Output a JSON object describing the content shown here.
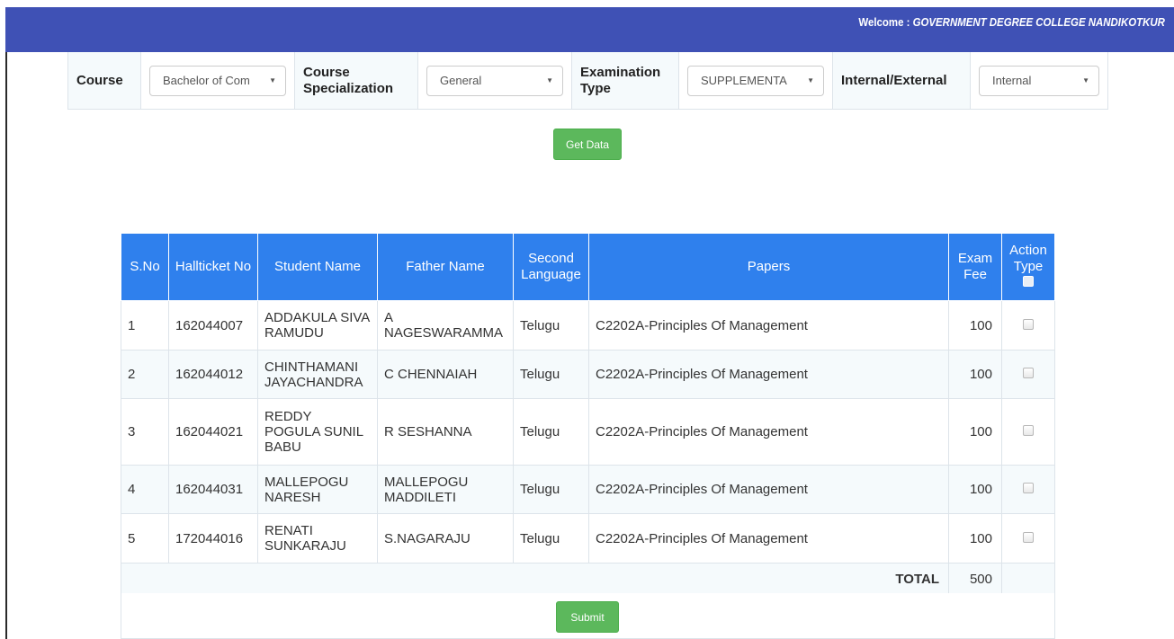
{
  "header": {
    "welcome_label": "Welcome :",
    "college_name": "GOVERNMENT DEGREE COLLEGE NANDIKOTKUR"
  },
  "filters": {
    "course_label": "Course",
    "course_value": "Bachelor of Com",
    "specialization_label": "Course Specialization",
    "specialization_value": "General",
    "exam_type_label": "Examination Type",
    "exam_type_value": "SUPPLEMENTA",
    "int_ext_label": "Internal/External",
    "int_ext_value": "Internal"
  },
  "get_data_label": "Get Data",
  "table": {
    "headers": {
      "sno": "S.No",
      "hallticket": "Hallticket No",
      "student": "Student Name",
      "father": "Father Name",
      "second_language": "Second Language",
      "papers": "Papers",
      "fee": "Exam Fee",
      "action": "Action Type"
    },
    "rows": [
      {
        "sno": "1",
        "hallticket": "162044007",
        "student": "ADDAKULA SIVA RAMUDU",
        "father": "A NAGESWARAMMA",
        "language": "Telugu",
        "papers": "C2202A-Principles Of Management",
        "fee": "100"
      },
      {
        "sno": "2",
        "hallticket": "162044012",
        "student": "CHINTHAMANI JAYACHANDRA",
        "father": "C CHENNAIAH",
        "language": "Telugu",
        "papers": "C2202A-Principles Of Management",
        "fee": "100"
      },
      {
        "sno": "3",
        "hallticket": "162044021",
        "student": "REDDY POGULA SUNIL BABU",
        "father": "R SESHANNA",
        "language": "Telugu",
        "papers": "C2202A-Principles Of Management",
        "fee": "100"
      },
      {
        "sno": "4",
        "hallticket": "162044031",
        "student": "MALLEPOGU NARESH",
        "father": "MALLEPOGU MADDILETI",
        "language": "Telugu",
        "papers": "C2202A-Principles Of Management",
        "fee": "100"
      },
      {
        "sno": "5",
        "hallticket": "172044016",
        "student": "RENATI SUNKARAJU",
        "father": "S.NAGARAJU",
        "language": "Telugu",
        "papers": "C2202A-Principles Of Management",
        "fee": "100"
      }
    ],
    "total_label": "TOTAL",
    "total_value": "500"
  },
  "submit_label": "Submit",
  "colors": {
    "topbar": "#3f51b5",
    "table_header": "#2f80ed",
    "button": "#5cb85c"
  }
}
